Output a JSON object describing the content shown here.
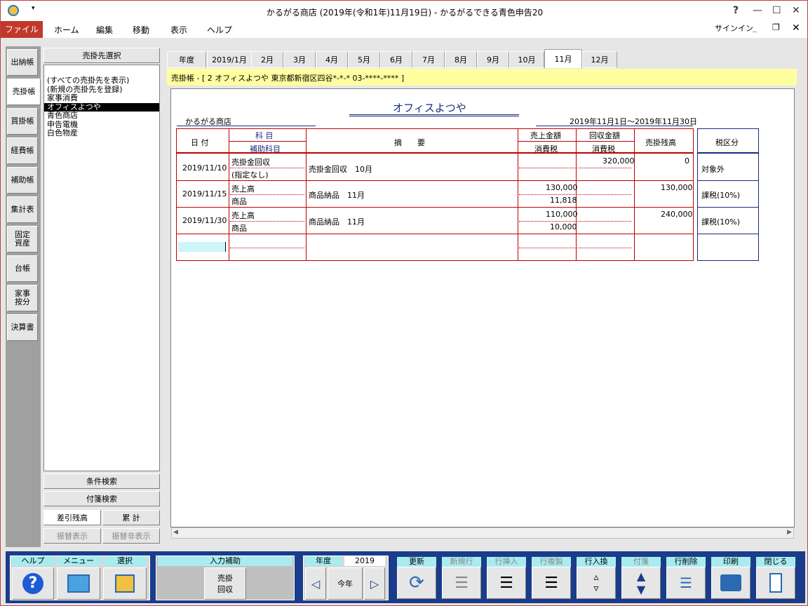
{
  "window": {
    "title": "かるがる商店 (2019年(令和1年)11月19日) - かるがるできる青色申告20",
    "help": "?",
    "minimize": "—",
    "maximize": "☐",
    "close": "✕"
  },
  "menu": {
    "file": "ファイル",
    "items": [
      "ホーム",
      "編集",
      "移動",
      "表示",
      "ヘルプ"
    ],
    "signin": "サインイン"
  },
  "sidetabs": [
    "出納帳",
    "売掛帳",
    "買掛帳",
    "経費帳",
    "補助帳",
    "集計表",
    "固定資産",
    "台帳",
    "家事按分",
    "決算書"
  ],
  "customer": {
    "header": "売掛先選択",
    "items": [
      "(すべての売掛先を表示)",
      "(新規の売掛先を登録)",
      "家事消費",
      "オフィスよつや",
      "青色商店",
      "申告電機",
      "白色物産"
    ],
    "selected": 3,
    "search_cond": "条件検索",
    "search_tag": "付箋検索",
    "opt1": "差引残高",
    "opt2": "累 計",
    "opt3": "振替表示",
    "opt4": "振替非表示"
  },
  "months": [
    "年度",
    "2019/1月",
    "2月",
    "3月",
    "4月",
    "5月",
    "6月",
    "7月",
    "8月",
    "9月",
    "10月",
    "11月",
    "12月"
  ],
  "active_month": 11,
  "ledger": {
    "header": "売掛帳 - [ 2 オフィスよつや 東京都新宿区四谷*-*-* 03-****-**** ]",
    "customer_name": "オフィスよつや",
    "company": "かるがる商店",
    "period": "2019年11月1日～2019年11月30日",
    "col_date": "日 付",
    "col_account": "科 目",
    "col_subaccount": "補助科目",
    "col_desc": "摘　　要",
    "col_sales": "売上金額",
    "col_tax1": "消費税",
    "col_collect": "回収金額",
    "col_tax2": "消費税",
    "col_balance": "売掛残高",
    "col_taxtype": "税区分",
    "rows": [
      {
        "date": "2019/11/10",
        "account": "売掛金回収",
        "sub": "(指定なし)",
        "desc": "売掛金回収　10月",
        "sales": "",
        "tax1": "",
        "collect": "320,000",
        "balance": "0",
        "taxtype": "対象外"
      },
      {
        "date": "2019/11/15",
        "account": "売上高",
        "sub": "商品",
        "desc": "商品納品　11月",
        "sales": "130,000",
        "tax1": "11,818",
        "collect": "",
        "balance": "130,000",
        "taxtype": "課税(10%)"
      },
      {
        "date": "2019/11/30",
        "account": "売上高",
        "sub": "商品",
        "desc": "商品納品　11月",
        "sales": "110,000",
        "tax1": "10,000",
        "collect": "",
        "balance": "240,000",
        "taxtype": "課税(10%)"
      }
    ]
  },
  "toolbar": {
    "help": "ヘルプ",
    "menu": "メニュー",
    "select": "選択",
    "input_assist": "入力補助",
    "urikake_kaishu": "売掛\n回収",
    "year": "年度",
    "year_value": "2019",
    "this_year": "今年",
    "update": "更新",
    "new_row": "新規行",
    "insert_row": "行挿入",
    "copy_row": "行複製",
    "swap_row": "行入換",
    "tag": "付箋",
    "delete_row": "行削除",
    "print": "印刷",
    "close": "閉じる"
  },
  "colors": {
    "accent": "#c0392b",
    "toolbar_bg": "#1a3c8a",
    "label_bg": "#a8ecf0",
    "header_yellow": "#ffffa0",
    "grid_red": "#c00000"
  }
}
